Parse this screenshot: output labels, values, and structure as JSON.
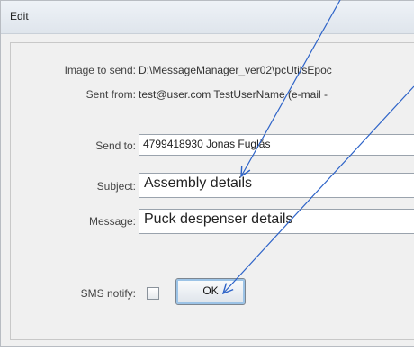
{
  "dialog": {
    "title": "Edit"
  },
  "info": {
    "image_label": "Image to send:",
    "image_value": "D:\\MessageManager_ver02\\pcUtilsEpoc",
    "sent_from_label": "Sent from:",
    "sent_from_value": "test@user.com TestUserName (e-mail -"
  },
  "form": {
    "send_to_label": "Send to:",
    "send_to_value": "4799418930 Jonas Fuglås",
    "subject_label": "Subject:",
    "subject_value": "Assembly details",
    "message_label": "Message:",
    "message_value": "Puck despenser details",
    "sms_notify_label": "SMS notify:",
    "sms_notify_checked": false,
    "ok_label": "OK"
  },
  "annotation_arrow_color": "#2d63c8"
}
